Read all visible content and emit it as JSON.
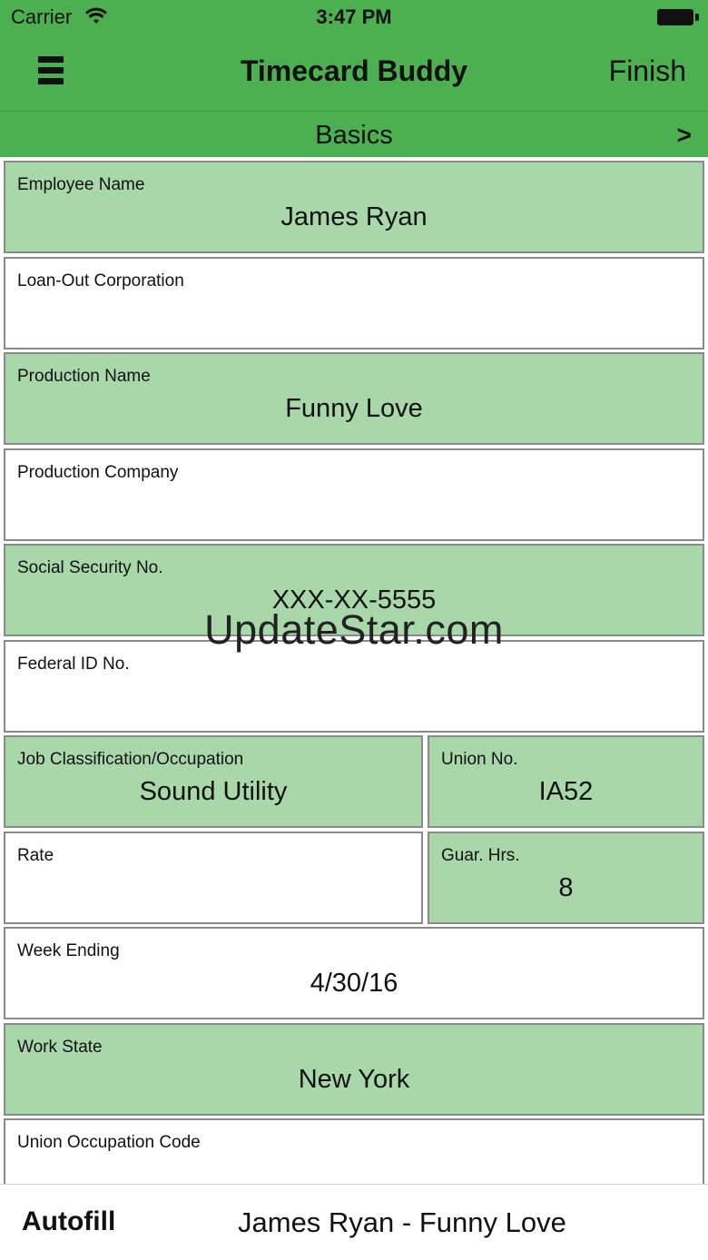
{
  "status_bar": {
    "carrier": "Carrier",
    "time": "3:47 PM"
  },
  "nav": {
    "title": "Timecard Buddy",
    "finish_label": "Finish",
    "menu_icon": "hamburger-menu-icon"
  },
  "section": {
    "title": "Basics",
    "next_label": ">"
  },
  "colors": {
    "header_green": "#4db050",
    "filled_field": "#a8d8a9",
    "empty_field": "#ffffff"
  },
  "fields": {
    "employee_name": {
      "label": "Employee Name",
      "value": "James Ryan"
    },
    "loan_out_corporation": {
      "label": "Loan-Out Corporation",
      "value": ""
    },
    "production_name": {
      "label": "Production Name",
      "value": "Funny Love"
    },
    "production_company": {
      "label": "Production Company",
      "value": ""
    },
    "social_security_no": {
      "label": "Social Security No.",
      "value": "XXX-XX-5555"
    },
    "federal_id_no": {
      "label": "Federal ID No.",
      "value": ""
    },
    "job_classification": {
      "label": "Job Classification/Occupation",
      "value": "Sound Utility"
    },
    "union_no": {
      "label": "Union No.",
      "value": "IA52"
    },
    "rate": {
      "label": "Rate",
      "value": ""
    },
    "guar_hrs": {
      "label": "Guar. Hrs.",
      "value": "8"
    },
    "week_ending": {
      "label": "Week Ending",
      "value": "4/30/16"
    },
    "work_state": {
      "label": "Work State",
      "value": "New York"
    },
    "union_occupation_code": {
      "label": "Union Occupation Code",
      "value": ""
    }
  },
  "watermark": "UpdateStar.com",
  "bottom_bar": {
    "autofill_label": "Autofill",
    "autofill_value": "James Ryan - Funny Love"
  }
}
